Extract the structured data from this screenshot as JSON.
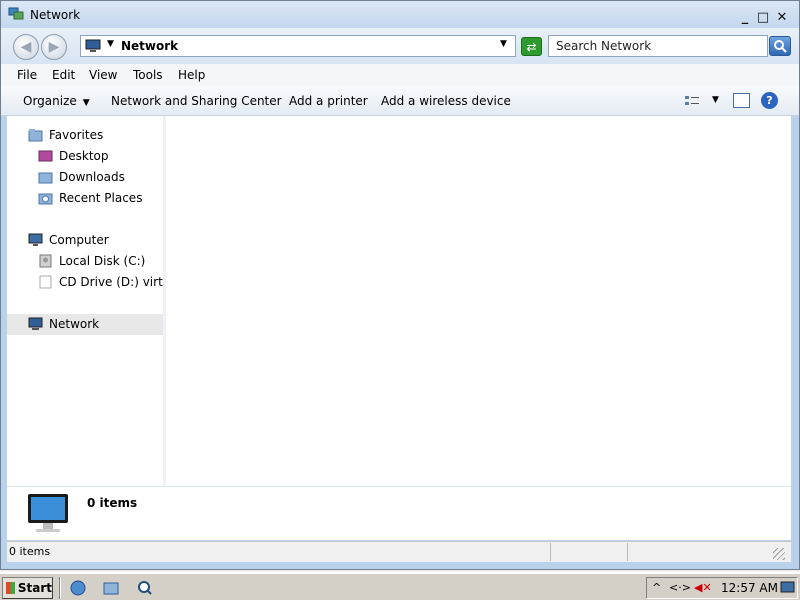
{
  "window": {
    "title": "Network",
    "buttons": {
      "minimize": "_",
      "maximize": "□",
      "close": "✕"
    }
  },
  "address": {
    "location": "Network",
    "search_placeholder": "Search Network"
  },
  "menu": [
    "File",
    "Edit",
    "View",
    "Tools",
    "Help"
  ],
  "toolbar": {
    "organize": "Organize",
    "items": [
      "Network and Sharing Center",
      "Add a printer",
      "Add a wireless device"
    ]
  },
  "navpane": {
    "favorites": {
      "label": "Favorites",
      "items": [
        "Desktop",
        "Downloads",
        "Recent Places"
      ]
    },
    "computer": {
      "label": "Computer",
      "items": [
        "Local Disk (C:)",
        "CD Drive (D:) virtio"
      ]
    },
    "network": {
      "label": "Network"
    }
  },
  "details": {
    "count": "0 items"
  },
  "status": {
    "text": "0 items"
  },
  "taskbar": {
    "start": "Start",
    "clock": "12:57 AM"
  },
  "colors": {
    "titlebar": "#c4d7ee",
    "selected_nav": "#e8e8e8",
    "taskbar": "#d4d0c8"
  }
}
